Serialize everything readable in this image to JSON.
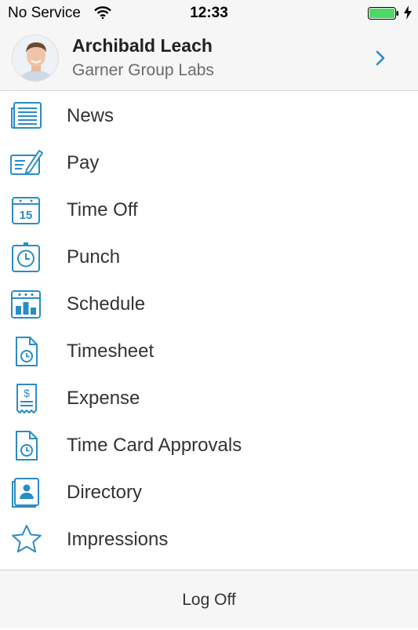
{
  "status_bar": {
    "carrier": "No Service",
    "time": "12:33",
    "wifi_icon": "wifi-icon",
    "battery_icon": "battery-icon",
    "charging_icon": "charging-bolt-icon",
    "battery_level": 1.0,
    "battery_color": "#4cd964"
  },
  "profile": {
    "name": "Archibald Leach",
    "organization": "Garner Group Labs",
    "avatar_icon": "avatar-photo",
    "chevron_icon": "chevron-right-icon"
  },
  "accent_color": "#2a8cc4",
  "menu": {
    "items": [
      {
        "label": "News",
        "icon": "news-icon"
      },
      {
        "label": "Pay",
        "icon": "pay-icon"
      },
      {
        "label": "Time Off",
        "icon": "calendar-15-icon",
        "icon_text": "15"
      },
      {
        "label": "Punch",
        "icon": "stopwatch-icon"
      },
      {
        "label": "Schedule",
        "icon": "schedule-icon"
      },
      {
        "label": "Timesheet",
        "icon": "timesheet-icon"
      },
      {
        "label": "Expense",
        "icon": "receipt-dollar-icon",
        "icon_text": "$"
      },
      {
        "label": "Time Card Approvals",
        "icon": "timecard-icon"
      },
      {
        "label": "Directory",
        "icon": "directory-icon"
      },
      {
        "label": "Impressions",
        "icon": "star-icon"
      }
    ]
  },
  "footer": {
    "log_off_label": "Log Off"
  }
}
